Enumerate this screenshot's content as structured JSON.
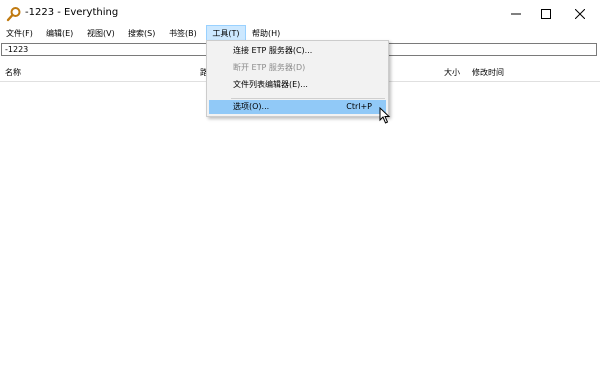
{
  "window": {
    "title": "-1223 - Everything",
    "controls": {
      "minimize": "–",
      "maximize": "☐",
      "close": "✕"
    }
  },
  "menubar": {
    "items": [
      {
        "label": "文件(F)"
      },
      {
        "label": "编辑(E)"
      },
      {
        "label": "视图(V)"
      },
      {
        "label": "搜索(S)"
      },
      {
        "label": "书签(B)"
      },
      {
        "label": "工具(T)",
        "active": true
      },
      {
        "label": "帮助(H)"
      }
    ]
  },
  "search": {
    "value": "-1223"
  },
  "columns": {
    "name": "名称",
    "path": "路",
    "size": "大小",
    "modified": "修改时间"
  },
  "tools_menu": {
    "items": [
      {
        "label": "连接 ETP 服务器(C)...",
        "enabled": true
      },
      {
        "label": "断开 ETP 服务器(D)",
        "enabled": false
      },
      {
        "label": "文件列表编辑器(E)...",
        "enabled": true
      },
      {
        "label": "选项(O)...",
        "shortcut": "Ctrl+P",
        "highlighted": true
      }
    ]
  },
  "colors": {
    "menu_active_bg": "#cce8ff",
    "dropdown_bg": "#f2f2f2",
    "highlight_bg": "#91c9f7",
    "disabled_text": "#8c8c8c"
  }
}
